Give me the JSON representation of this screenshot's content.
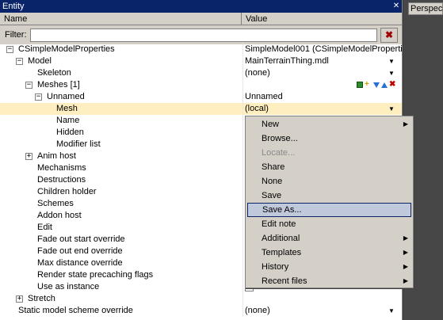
{
  "window": {
    "title": "Entity",
    "close_glyph": "✕"
  },
  "columns": {
    "name": "Name",
    "value": "Value"
  },
  "filter": {
    "label": "Filter:",
    "value": "",
    "clear_glyph": "✖"
  },
  "viewport": {
    "label": "Perspective"
  },
  "rows": [
    {
      "name": "CSimpleModelProperties",
      "value": "SimpleModel001 (CSimpleModelProperties",
      "expander": "−"
    },
    {
      "name": "Model",
      "value": "MainTerrainThing.mdl",
      "expander": "−",
      "dropdown": "▼"
    },
    {
      "name": "Skeleton",
      "value": "(none)",
      "dropdown": "▼"
    },
    {
      "name": "Meshes [1]",
      "value": "",
      "expander": "−"
    },
    {
      "name": "Unnamed",
      "value": "Unnamed",
      "expander": "−"
    },
    {
      "name": "Mesh",
      "value": "(local)",
      "dropdown": "▼"
    },
    {
      "name": "Name",
      "value": ""
    },
    {
      "name": "Hidden",
      "value": ""
    },
    {
      "name": "Modifier list",
      "value": ""
    },
    {
      "name": "Anim host",
      "value": "",
      "expander": "+"
    },
    {
      "name": "Mechanisms",
      "value": ""
    },
    {
      "name": "Destructions",
      "value": ""
    },
    {
      "name": "Children holder",
      "value": ""
    },
    {
      "name": "Schemes",
      "value": ""
    },
    {
      "name": "Addon host",
      "value": ""
    },
    {
      "name": "Edit",
      "value": ""
    },
    {
      "name": "Fade out start override",
      "value": ""
    },
    {
      "name": "Fade out end override",
      "value": ""
    },
    {
      "name": "Max distance override",
      "value": ""
    },
    {
      "name": "Render state precaching flags",
      "value": ""
    },
    {
      "name": "Use as instance",
      "value": ""
    },
    {
      "name": "Stretch",
      "value": "",
      "expander": "+"
    },
    {
      "name": "Static model scheme override",
      "value": "(none)",
      "dropdown": "▼"
    }
  ],
  "context_menu": {
    "submenu_glyph": "▶",
    "items": [
      {
        "label": "New",
        "submenu": true
      },
      {
        "label": "Browse..."
      },
      {
        "label": "Locate...",
        "disabled": true
      },
      {
        "label": "Share"
      },
      {
        "label": "None"
      },
      {
        "label": "Save"
      },
      {
        "label": "Save As...",
        "selected": true
      },
      {
        "label": "Edit note"
      },
      {
        "label": "Additional",
        "submenu": true
      },
      {
        "label": "Templates",
        "submenu": true
      },
      {
        "label": "History",
        "submenu": true
      },
      {
        "label": "Recent files",
        "submenu": true
      }
    ]
  }
}
